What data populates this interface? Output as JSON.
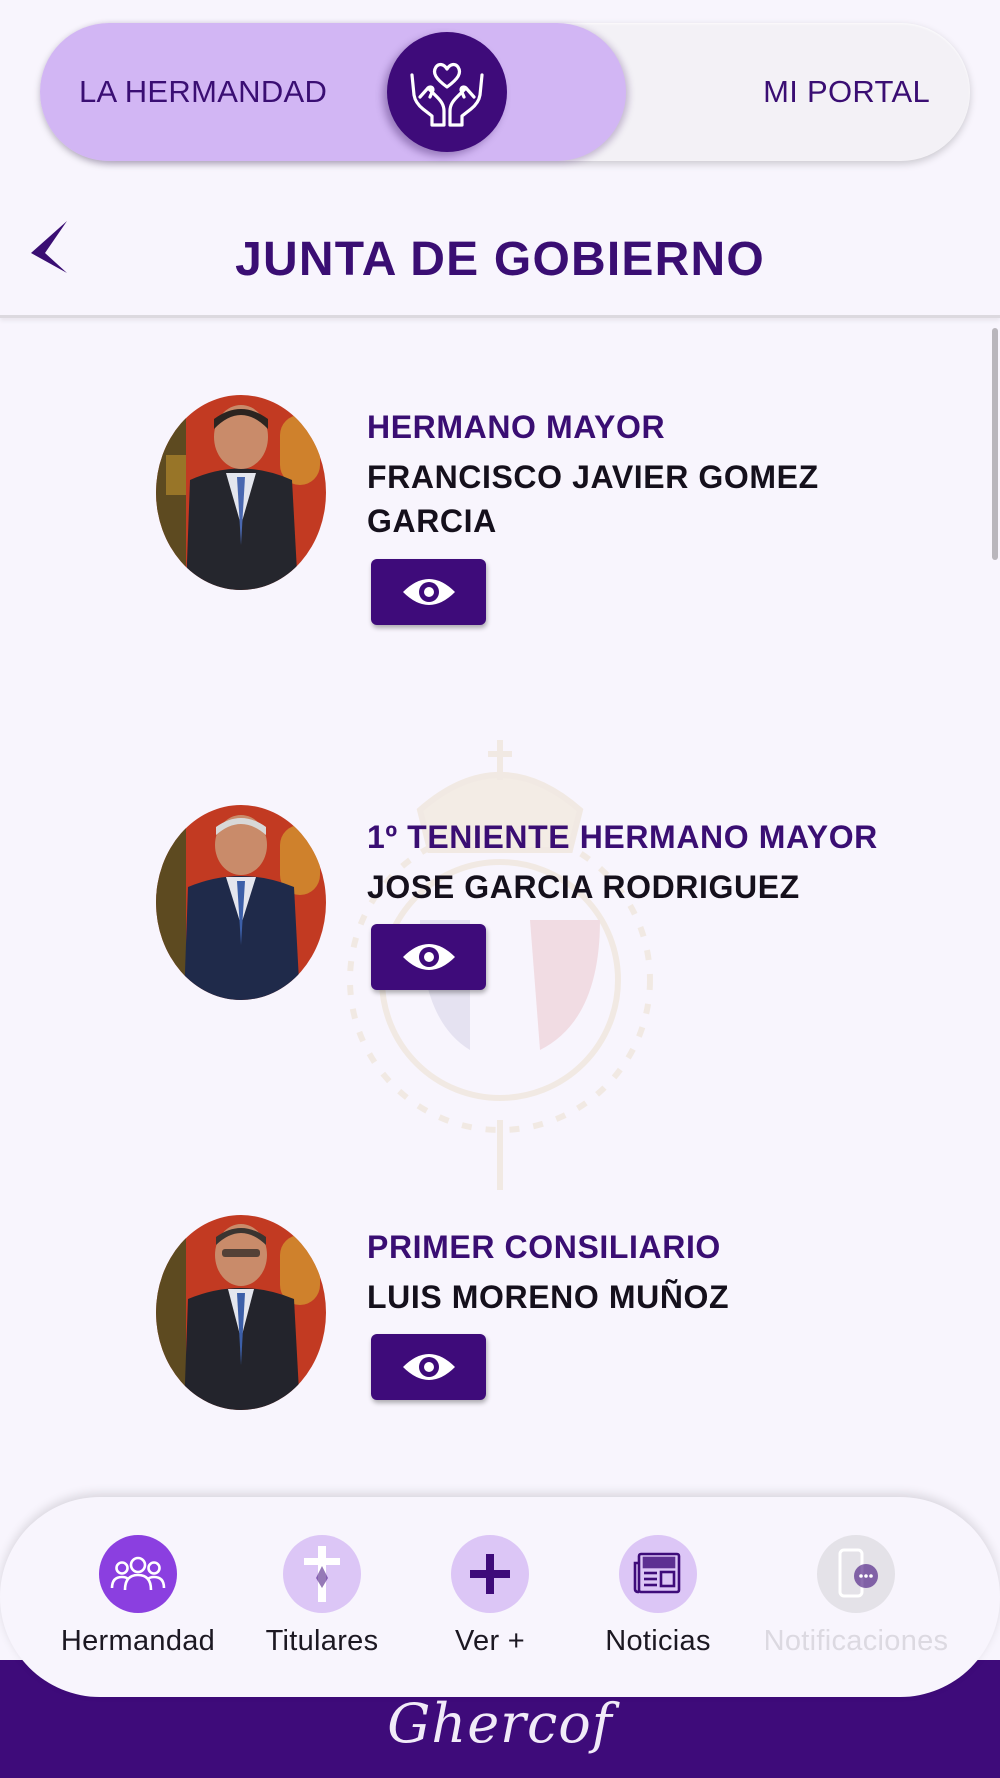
{
  "switch": {
    "left_label": "LA HERMANDAD",
    "right_label": "MI PORTAL",
    "center_icon": "hands-heart-icon"
  },
  "header": {
    "title": "JUNTA DE GOBIERNO",
    "back_icon": "back-arrow-icon"
  },
  "members": [
    {
      "role": "HERMANO MAYOR",
      "name": "FRANCISCO JAVIER GOMEZ GARCIA",
      "button_icon": "eye-icon"
    },
    {
      "role": "1º TENIENTE HERMANO MAYOR",
      "name": "JOSE GARCIA RODRIGUEZ",
      "button_icon": "eye-icon"
    },
    {
      "role": "PRIMER CONSILIARIO",
      "name": "LUIS MORENO MUÑOZ",
      "button_icon": "eye-icon"
    }
  ],
  "nav": {
    "items": [
      {
        "label": "Hermandad",
        "icon": "group-icon",
        "active": true
      },
      {
        "label": "Titulares",
        "icon": "cross-icon",
        "active": false
      },
      {
        "label": "Ver +",
        "icon": "plus-icon",
        "active": false
      },
      {
        "label": "Noticias",
        "icon": "newspaper-icon",
        "active": false
      },
      {
        "label": "Notificaciones",
        "icon": "phone-chat-icon",
        "active": false,
        "disabled": true
      }
    ]
  },
  "footer": {
    "logo": "Ghercof"
  },
  "colors": {
    "primary": "#3e0b7a",
    "primary_light": "#d2b6f4",
    "nav_active": "#8b3fe0",
    "nav_inactive": "#dcc6f6",
    "background": "#f8f5fd"
  }
}
